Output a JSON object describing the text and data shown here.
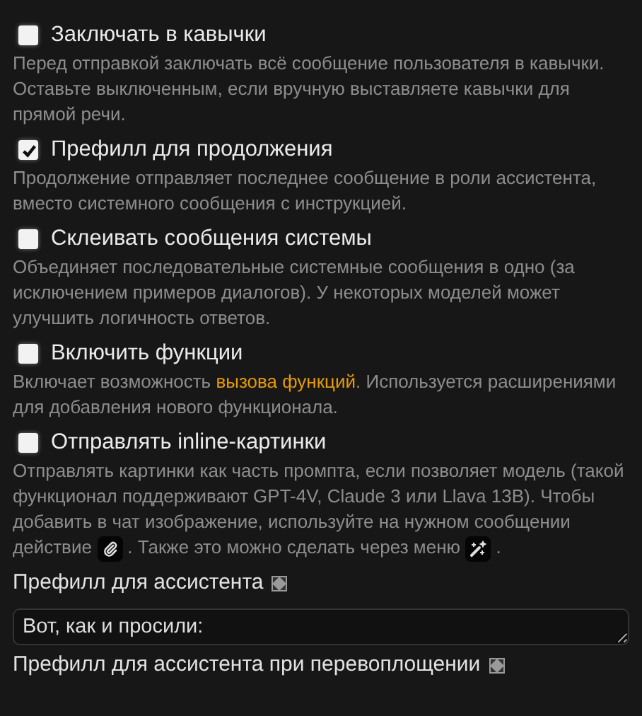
{
  "options": [
    {
      "label": "Заключать в кавычки",
      "checked": false,
      "description": [
        [
          {
            "kind": "text",
            "text": "Перед отправкой заключать всё сообщение пользователя в кавычки."
          }
        ],
        [
          {
            "kind": "text",
            "text": "Оставьте выключенным, если вручную выставляете кавычки для прямой речи."
          }
        ]
      ]
    },
    {
      "label": "Префилл для продолжения",
      "checked": true,
      "description": [
        [
          {
            "kind": "text",
            "text": "Продолжение отправляет последнее сообщение в роли ассистента, вместо системного сообщения с инструкцией."
          }
        ]
      ]
    },
    {
      "label": "Склеивать сообщения системы",
      "checked": false,
      "description": [
        [
          {
            "kind": "text",
            "text": "Объединяет последовательные системные сообщения в одно (за исключением примеров диалогов). У некоторых моделей может улучшить логичность ответов."
          }
        ]
      ]
    },
    {
      "label": "Включить функции",
      "checked": false,
      "description": [
        [
          {
            "kind": "text",
            "text": "Включает возможность "
          },
          {
            "kind": "link",
            "text": "вызова функций"
          },
          {
            "kind": "text",
            "text": ". Используется расширениями для добавления нового функционала."
          }
        ]
      ]
    },
    {
      "label": "Отправлять inline-картинки",
      "checked": false,
      "description": [
        [
          {
            "kind": "text",
            "text": "Отправлять картинки как часть промпта, если позволяет модель (такой функционал поддерживают GPT-4V, Claude 3 или Llava 13B). Чтобы добавить в чат изображение, используйте на нужном сообщении действие "
          },
          {
            "kind": "clip"
          },
          {
            "kind": "text",
            "text": " . Также это можно сделать через меню "
          },
          {
            "kind": "wand"
          },
          {
            "kind": "text",
            "text": " ."
          }
        ]
      ]
    }
  ],
  "fields": [
    {
      "label": "Префилл для ассистента",
      "value": "Вот, как и просили:"
    },
    {
      "label": "Префилл для ассистента при перевоплощении"
    }
  ]
}
